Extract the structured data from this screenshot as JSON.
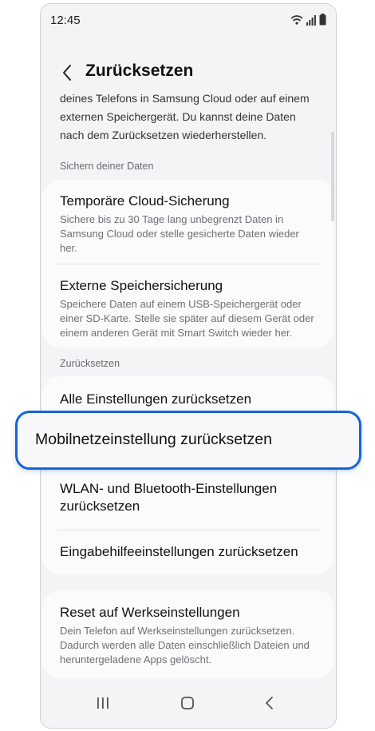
{
  "status": {
    "time": "12:45"
  },
  "header": {
    "title": "Zurücksetzen"
  },
  "intro_lines": [
    "deines Telefons in Samsung Cloud oder auf einem",
    "externen Speichergerät. Du kannst deine Daten",
    "nach dem Zurücksetzen wiederherstellen."
  ],
  "backup": {
    "section_label": "Sichern deiner Daten",
    "items": [
      {
        "title": "Temporäre Cloud-Sicherung",
        "desc_lines": [
          "Sichere bis zu 30 Tage lang unbegrenzt Daten in",
          "Samsung Cloud oder stelle gesicherte Daten wieder",
          "her."
        ]
      },
      {
        "title": "Externe Speichersicherung",
        "desc_lines": [
          "Speichere Daten auf einem USB-Speichergerät oder",
          "einer SD-Karte. Stelle sie später auf diesem Gerät oder",
          "einem anderen Gerät mit Smart Switch wieder her."
        ]
      }
    ]
  },
  "reset": {
    "section_label": "Zurücksetzen",
    "items": [
      {
        "title": "Alle Einstellungen zurücksetzen"
      },
      {
        "title": "Mobilnetzeinstellung zurücksetzen"
      },
      {
        "title_lines": [
          "WLAN- und Bluetooth-Einstellungen",
          "zurücksetzen"
        ]
      },
      {
        "title": "Eingabehilfeeinstellungen zurücksetzen"
      }
    ]
  },
  "factory": {
    "title": "Reset auf Werkseinstellungen",
    "desc_lines": [
      "Dein Telefon auf Werkseinstellungen zurücksetzen.",
      "Dadurch werden alle Daten einschließlich Dateien und",
      "heruntergeladene Apps gelöscht."
    ]
  },
  "icons": {
    "back": "chevron-left-icon",
    "wifi": "wifi-icon",
    "signal": "signal-icon",
    "battery": "battery-icon",
    "nav_recents": "recents-icon",
    "nav_home": "home-icon",
    "nav_back": "back-icon"
  },
  "colors": {
    "highlight_border": "#1565d8",
    "background": "#f4f4f6",
    "card": "#fbfbfc"
  }
}
